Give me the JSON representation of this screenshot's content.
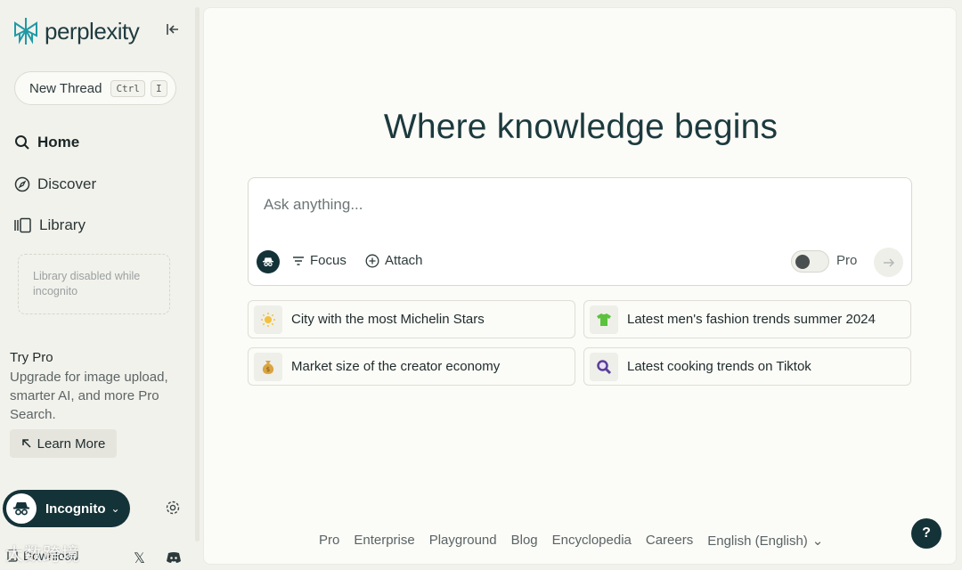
{
  "brand": {
    "name": "perplexity",
    "accent": "#1f9aa6",
    "dark": "#143338"
  },
  "sidebar": {
    "new_thread": {
      "label": "New Thread",
      "shortcut": [
        "Ctrl",
        "I"
      ]
    },
    "nav": [
      {
        "label": "Home",
        "icon": "search-icon"
      },
      {
        "label": "Discover",
        "icon": "compass-icon"
      },
      {
        "label": "Library",
        "icon": "library-icon"
      }
    ],
    "library_disabled": "Library disabled while incognito",
    "try_pro": {
      "title": "Try Pro",
      "description": "Upgrade for image upload, smarter AI, and more Pro Search.",
      "cta": "Learn More"
    },
    "incognito_label": "Incognito",
    "download_label": "Download",
    "watermark": "大数跨境"
  },
  "main": {
    "headline": "Where knowledge begins",
    "search": {
      "placeholder": "Ask anything...",
      "focus_label": "Focus",
      "attach_label": "Attach",
      "pro_label": "Pro",
      "pro_enabled": false
    },
    "suggestions": [
      {
        "icon": "sun-icon",
        "label": "City with the most Michelin Stars"
      },
      {
        "icon": "shirt-icon",
        "label": "Latest men's fashion trends summer 2024"
      },
      {
        "icon": "money-bag-icon",
        "label": "Market size of the creator economy"
      },
      {
        "icon": "magnifier-icon",
        "label": "Latest cooking trends on Tiktok"
      }
    ],
    "footer": [
      "Pro",
      "Enterprise",
      "Playground",
      "Blog",
      "Encyclopedia",
      "Careers"
    ],
    "language": "English (English)",
    "help_label": "?"
  }
}
